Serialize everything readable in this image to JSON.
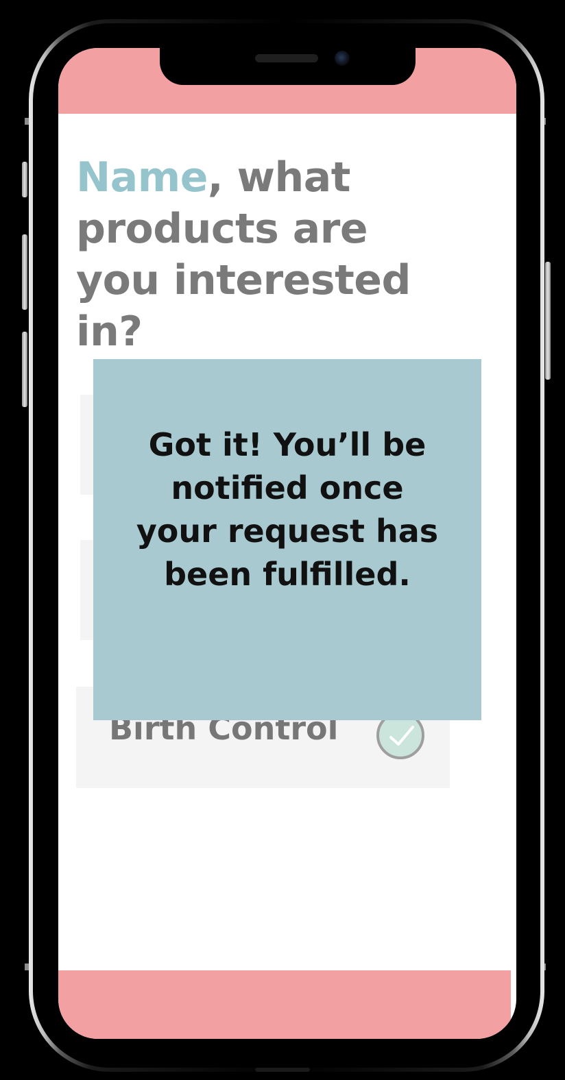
{
  "heading": {
    "name": "Name",
    "rest": ", what products are you interested in?"
  },
  "options": [
    {
      "label": "Birth Control",
      "checked": true
    }
  ],
  "toast": {
    "message": "Got it! You’ll be notified once your request has been fulfilled."
  },
  "colors": {
    "accent_pink": "#f3a0a2",
    "accent_blue": "#95c4cc",
    "toast_bg": "#a8c9d0",
    "check_fill": "#cbe5dc"
  },
  "icons": {
    "checkmark": "check-icon"
  }
}
